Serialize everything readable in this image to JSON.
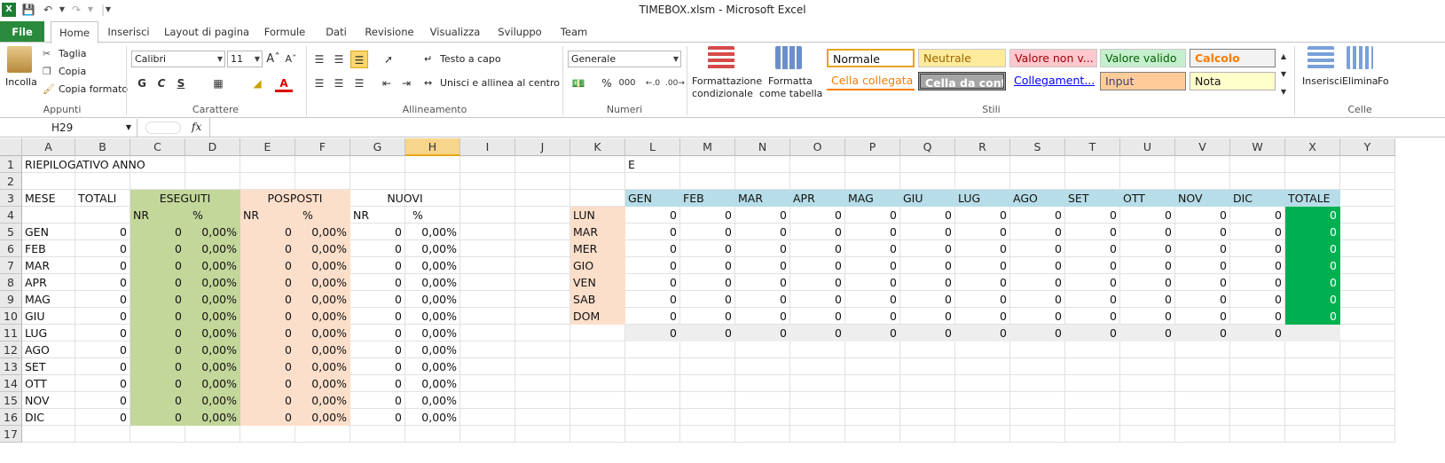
{
  "window_title": "TIMEBOX.xlsm  -  Microsoft Excel",
  "tabs": [
    "File",
    "Home",
    "Inserisci",
    "Layout di pagina",
    "Formule",
    "Dati",
    "Revisione",
    "Visualizza",
    "Sviluppo",
    "Team"
  ],
  "ribbon": {
    "clipboard": {
      "paste": "Incolla",
      "cut": "Taglia",
      "copy": "Copia",
      "format_painter": "Copia formato",
      "group": "Appunti"
    },
    "font": {
      "name": "Calibri",
      "size": "11",
      "bold": "G",
      "italic": "C",
      "underline": "S",
      "group": "Carattere"
    },
    "alignment": {
      "wrap": "Testo a capo",
      "merge": "Unisci e allinea al centro",
      "group": "Allineamento"
    },
    "number": {
      "format": "Generale",
      "percent": "%",
      "thousands": "000",
      "group": "Numeri"
    },
    "styles": {
      "conditional": [
        "Formattazione",
        "condizionale"
      ],
      "as_table": [
        "Formatta",
        "come tabella"
      ],
      "group": "Stili",
      "cells": [
        "Normale",
        "Neutrale",
        "Valore non v...",
        "Valore valido",
        "Calcolo",
        "Cella collegata",
        "Cella da cont...",
        "Collegament...",
        "Input",
        "Nota"
      ]
    },
    "cells": {
      "insert": "Inserisci",
      "delete": "Elimina",
      "format": "Fo",
      "group": "Celle"
    }
  },
  "formula_bar": {
    "name_box": "H29",
    "fx": "fx",
    "formula": ""
  },
  "columns": [
    "A",
    "B",
    "C",
    "D",
    "E",
    "F",
    "G",
    "H",
    "I",
    "J",
    "K",
    "L",
    "M",
    "N",
    "O",
    "P",
    "Q",
    "R",
    "S",
    "T",
    "U",
    "V",
    "W",
    "X",
    "Y"
  ],
  "selected_column": "H",
  "rows": [
    "1",
    "2",
    "3",
    "4",
    "5",
    "6",
    "7",
    "8",
    "9",
    "10",
    "11",
    "12",
    "13",
    "14",
    "15",
    "16",
    "17"
  ],
  "sheet": {
    "title": "RIEPILOGATIVO ANNO",
    "l1": "E",
    "headers": {
      "mese": "MESE",
      "totali": "TOTALI",
      "eseguiti": "ESEGUITI",
      "posposti": "POSPOSTI",
      "nuovi": "NUOVI"
    },
    "sub_headers": [
      "NR",
      "%",
      "NR",
      "%",
      "NR",
      "%"
    ],
    "months": [
      "GEN",
      "FEB",
      "MAR",
      "APR",
      "MAG",
      "GIU",
      "LUG",
      "AGO",
      "SET",
      "OTT",
      "NOV",
      "DIC"
    ],
    "zero": "0",
    "pct": "0,00%",
    "week_days": [
      "LUN",
      "MAR",
      "MER",
      "GIO",
      "VEN",
      "SAB",
      "DOM"
    ],
    "month_headers": [
      "GEN",
      "FEB",
      "MAR",
      "APR",
      "MAG",
      "GIU",
      "LUG",
      "AGO",
      "SET",
      "OTT",
      "NOV",
      "DIC"
    ],
    "totale": "TOTALE"
  },
  "colors": {
    "excel_green": "#2a8a3c",
    "eseguiti": "#c4d79b",
    "posposti": "#fcdfcb",
    "month_header": "#b7dde8",
    "totale": "#00b050"
  }
}
